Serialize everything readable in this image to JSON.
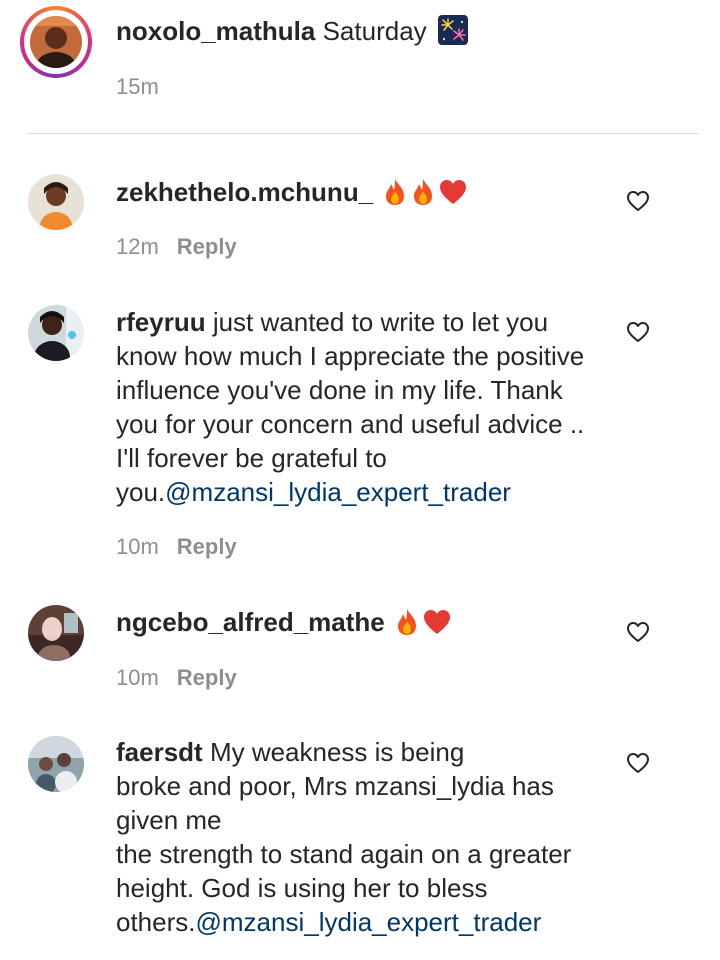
{
  "caption": {
    "username": "noxolo_mathula",
    "text": "Saturday",
    "emoji": "fireworks-icon",
    "time": "15m"
  },
  "reply_label": "Reply",
  "comments": [
    {
      "username": "zekhethelo.mchunu_",
      "text": "",
      "mention": "",
      "emojis": [
        "fire-icon",
        "fire-icon",
        "red-heart-icon"
      ],
      "time": "12m"
    },
    {
      "username": "rfeyruu",
      "text": "just wanted to write to let you know how much I appreciate the positive influence you've done in my life. Thank you for your concern and useful advice .. I'll forever be grateful to you.",
      "mention": "@mzansi_lydia_expert_trader",
      "emojis": [],
      "time": "10m"
    },
    {
      "username": "ngcebo_alfred_mathe",
      "text": "",
      "mention": "",
      "emojis": [
        "fire-icon",
        "red-heart-icon"
      ],
      "time": "10m"
    },
    {
      "username": "faersdt",
      "text": "My weakness is being\nbroke and poor, Mrs mzansi_lydia has given me\nthe strength to stand again on a greater height. God is using her to bless others.",
      "mention": "@mzansi_lydia_expert_trader",
      "emojis": [],
      "time": ""
    }
  ]
}
